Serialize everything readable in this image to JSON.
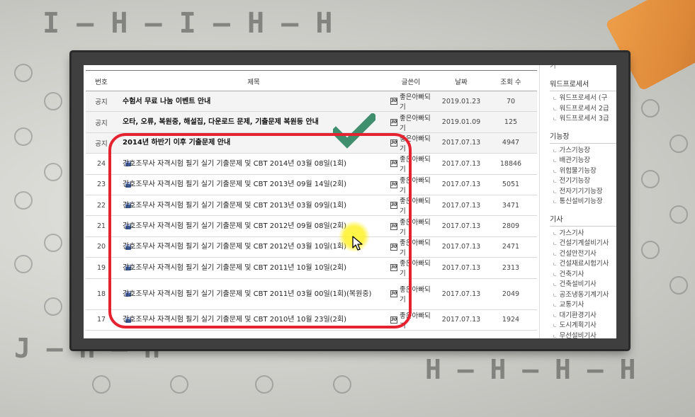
{
  "board": {
    "headers": {
      "num": "번호",
      "title": "제목",
      "author": "글쓴이",
      "date": "날짜",
      "views": "조회 수"
    },
    "rows": [
      {
        "num": "공지",
        "title": "수험서 무료 나눔 이벤트 안내",
        "author": "좋은아빠되기",
        "date": "2019.01.23",
        "views": "70",
        "notice": true
      },
      {
        "num": "공지",
        "title": "오타, 오류, 복원중, 해설집, 다운로드 문제, 기출문제 복원등 안내",
        "author": "좋은아빠되기",
        "date": "2019.01.09",
        "views": "125",
        "notice": true
      },
      {
        "num": "공지",
        "title": "2014년 하반기 이후 기출문제 안내",
        "author": "좋은아빠되기",
        "date": "2017.07.13",
        "views": "4947",
        "notice": true
      },
      {
        "num": "24",
        "title": "간호조무사 자격시험 필기 실기 기출문제 및 CBT 2014년 03월 08일(1회)",
        "author": "좋은아빠되기",
        "date": "2017.07.13",
        "views": "18846"
      },
      {
        "num": "23",
        "title": "간호조무사 자격시험 필기 실기 기출문제 및 CBT 2013년 09월 14일(2회)",
        "author": "좋은아빠되기",
        "date": "2017.07.13",
        "views": "5051"
      },
      {
        "num": "22",
        "title": "간호조무사 자격시험 필기 실기 기출문제 및 CBT 2013년 03월 09일(1회)",
        "author": "좋은아빠되기",
        "date": "2017.07.13",
        "views": "3471"
      },
      {
        "num": "21",
        "title": "간호조무사 자격시험 필기 실기 기출문제 및 CBT 2012년 09월 08일(2회)",
        "author": "좋은아빠되기",
        "date": "2017.07.13",
        "views": "2809"
      },
      {
        "num": "20",
        "title": "간호조무사 자격시험 필기 실기 기출문제 및 CBT 2012년 03월 10일(1회)",
        "author": "좋은아빠되기",
        "date": "2017.07.13",
        "views": "2471"
      },
      {
        "num": "19",
        "title": "간호조무사 자격시험 필기 실기 기출문제 및 CBT 2011년 10월 10일(2회)",
        "author": "좋은아빠되기",
        "date": "2017.07.13",
        "views": "2313"
      },
      {
        "num": "18",
        "title": "간호조무사 자격시험 필기 실기 기출문제 및 CBT 2011년 03월 00일(1회)(복원중)",
        "author": "좋은아빠되기",
        "date": "2017.07.13",
        "views": "2049",
        "tall": true
      },
      {
        "num": "17",
        "title": "간호조무사 자격시험 필기 실기 기출문제 및 CBT 2010년 10월 23일(2회)",
        "author": "좋은아빠되기",
        "date": "2017.07.13",
        "views": "1924"
      }
    ],
    "author_icon_text": "30"
  },
  "sidebar": {
    "top_cut": "기",
    "groups": [
      {
        "title": "워드프로세서",
        "items": [
          "워드프로세서 (구",
          "워드프로세서 2급",
          "워드프로세서 3급"
        ]
      },
      {
        "title": "기능장",
        "items": [
          "가스기능장",
          "배관기능장",
          "위험물기능장",
          "전기기능장",
          "전자기기기능장",
          "통신설비기능장"
        ]
      },
      {
        "title": "기사",
        "items": [
          "가스기사",
          "건설기계설비기사",
          "건설안전기사",
          "건설재료시험기사",
          "건축기사",
          "건축설비기사",
          "공조냉동기계기사",
          "교통기사",
          "대기환경기사",
          "도시계획기사",
          "무선설비기사",
          "방사선비파괴검사"
        ]
      }
    ]
  },
  "watermark": "...",
  "colors": {
    "highlight_box": "#e52330",
    "check": "#3f8f6f",
    "cursor_glow": "#fff23c"
  }
}
